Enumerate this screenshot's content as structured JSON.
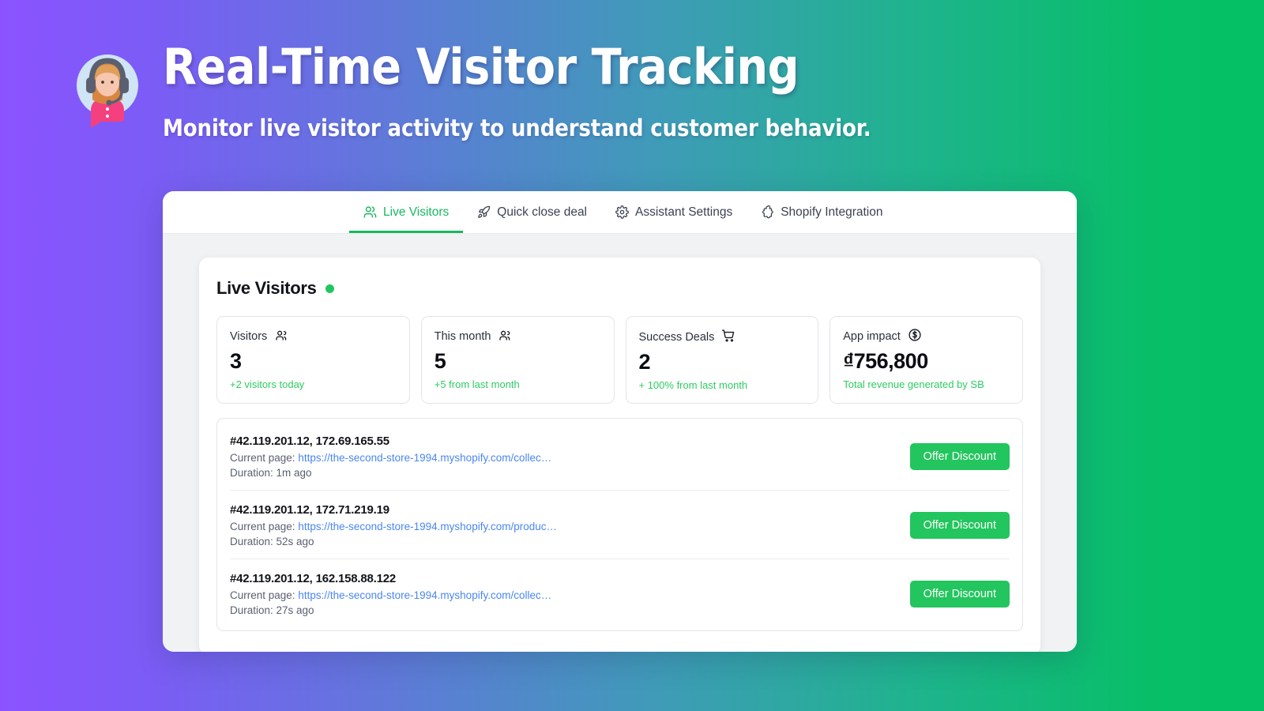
{
  "theme": {
    "gradient_start": "#8B53FF",
    "gradient_end": "#07BF66",
    "accent_green": "#17b95f",
    "button_green": "#23c55e",
    "link_blue": "#4a87f0",
    "panel_bg": "#F1F2F4"
  },
  "hero": {
    "title": "Real-Time Visitor Tracking",
    "subtitle": "Monitor live visitor activity to understand customer behavior.",
    "avatar_icon": "support-agent-avatar-icon"
  },
  "tabs": [
    {
      "label": "Live Visitors",
      "icon": "users-icon",
      "active": true
    },
    {
      "label": "Quick close deal",
      "icon": "rocket-icon",
      "active": false
    },
    {
      "label": "Assistant Settings",
      "icon": "gear-icon",
      "active": false
    },
    {
      "label": "Shopify Integration",
      "icon": "puzzle-icon",
      "active": false
    }
  ],
  "panel": {
    "title": "Live Visitors",
    "status_dot": "live-indicator"
  },
  "stats": [
    {
      "label": "Visitors",
      "icon": "users-icon",
      "value": "3",
      "sub": "+2 visitors today"
    },
    {
      "label": "This month",
      "icon": "users-icon",
      "value": "5",
      "sub": "+5 from last month"
    },
    {
      "label": "Success Deals",
      "icon": "cart-icon",
      "value": "2",
      "sub": "+ 100% from last month"
    },
    {
      "label": "App impact",
      "icon": "dollar-circle-icon",
      "value": "₫756,800",
      "sub": "Total revenue generated by SB"
    }
  ],
  "visitors": [
    {
      "ip": "#42.119.201.12, 172.69.165.55",
      "page_label": "Current page:",
      "page_url": "https://the-second-store-1994.myshopify.com/collec…",
      "duration": "Duration: 1m ago",
      "action": "Offer Discount"
    },
    {
      "ip": "#42.119.201.12, 172.71.219.19",
      "page_label": "Current page:",
      "page_url": "https://the-second-store-1994.myshopify.com/produc…",
      "duration": "Duration: 52s ago",
      "action": "Offer Discount"
    },
    {
      "ip": "#42.119.201.12, 162.158.88.122",
      "page_label": "Current page:",
      "page_url": "https://the-second-store-1994.myshopify.com/collec…",
      "duration": "Duration: 27s ago",
      "action": "Offer Discount"
    }
  ]
}
